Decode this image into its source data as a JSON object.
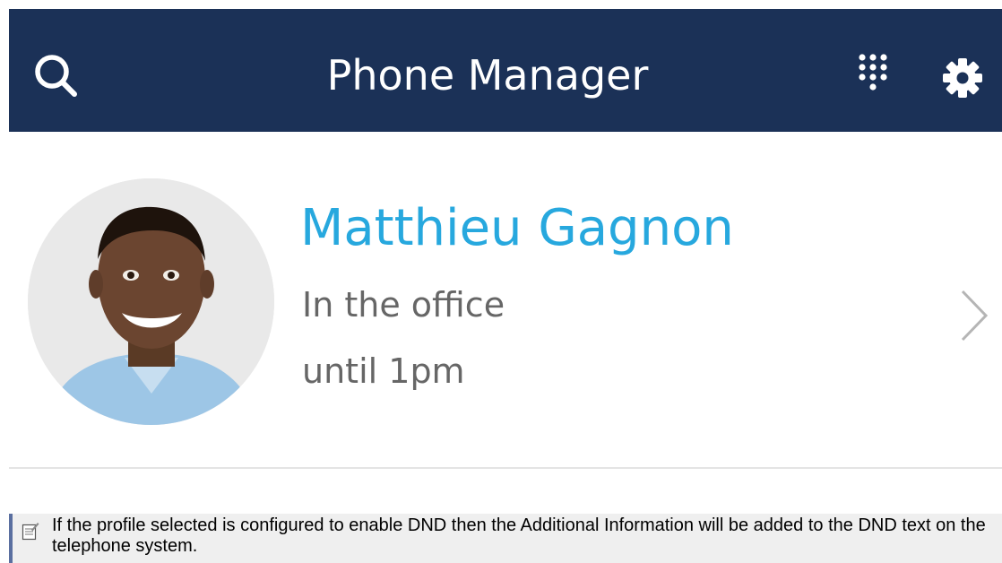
{
  "header": {
    "title": "Phone Manager",
    "background_color": "#1b3157",
    "icons": {
      "search": "search-icon",
      "dialpad": "dialpad-icon",
      "settings": "gear-icon"
    }
  },
  "profile": {
    "name": "Matthieu Gagnon",
    "status": "In the office",
    "until": "until 1pm",
    "name_color": "#27a8de",
    "chevron_icon": "chevron-right-icon"
  },
  "note": {
    "icon": "note-icon",
    "text": "If the profile selected is configured to enable DND then the Additional Information will be added to the DND text on the telephone system."
  }
}
